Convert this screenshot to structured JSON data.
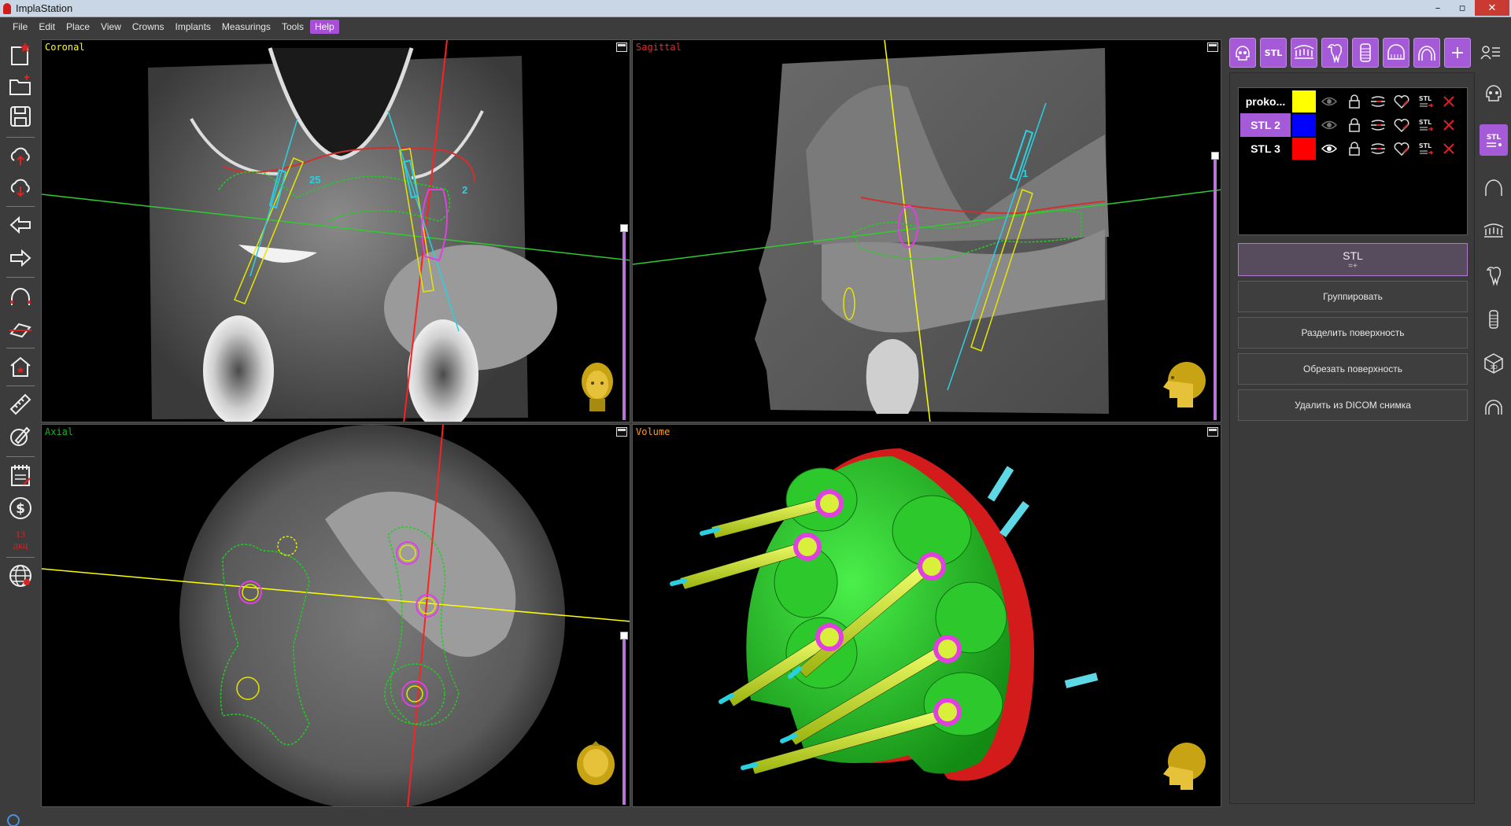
{
  "window": {
    "title": "ImplaStation",
    "minimize": "–",
    "maximize": "▫",
    "close": "✕"
  },
  "menu": [
    "File",
    "Edit",
    "Place",
    "View",
    "Crowns",
    "Implants",
    "Measurings",
    "Tools",
    "Help"
  ],
  "menu_active": "Help",
  "left_toolbar": {
    "tools": [
      "new-project-icon",
      "open-folder-icon",
      "save-icon",
      "cloud-upload-icon",
      "cloud-download-icon",
      "undo-arrow-icon",
      "redo-arrow-icon",
      "arch-curve-icon",
      "cut-plane-icon",
      "home-view-icon",
      "ruler-icon",
      "edit-measure-icon",
      "report-icon",
      "price-icon",
      "globe-icon"
    ],
    "counter_value": "13",
    "counter_unit": "дкц"
  },
  "viewports": {
    "coronal": {
      "label": "Coronal",
      "color": "#ffff00",
      "markers": [
        "25",
        "2"
      ]
    },
    "sagittal": {
      "label": "Sagittal",
      "color": "#ff2020",
      "markers": [
        "1"
      ]
    },
    "axial": {
      "label": "Axial",
      "color": "#1fae1f"
    },
    "volume": {
      "label": "Volume",
      "color": "#ff9b2a"
    }
  },
  "right_top_buttons": [
    "skull-icon",
    "STL",
    "arch-teeth-icon",
    "tooth-icon",
    "implant-icon",
    "guide-icon",
    "arch-icon",
    "+",
    "user-list-icon"
  ],
  "layers": [
    {
      "name": "proko...",
      "name_bg": "#000000",
      "color": "#ffff00",
      "visible": false
    },
    {
      "name": "STL 2",
      "name_bg": "#a55ad8",
      "color": "#0000ff",
      "visible": false
    },
    {
      "name": "STL 3",
      "name_bg": "#000000",
      "color": "#ff0000",
      "visible": true
    }
  ],
  "stl_button": {
    "label": "STL",
    "sub": "=+"
  },
  "actions": [
    "Группировать",
    "Разделить поверхность",
    "Обрезать поверхность",
    "Удалить из DICOM снимка"
  ],
  "right_side_icons": [
    "skull-icon",
    "stl-icon",
    "arch-icon",
    "teeth-row-icon",
    "tooth-icon",
    "implant-icon",
    "cube-3d-icon",
    "headphone-arch-icon"
  ],
  "stl_icon_label": "STL",
  "accent": "#a55ad8"
}
